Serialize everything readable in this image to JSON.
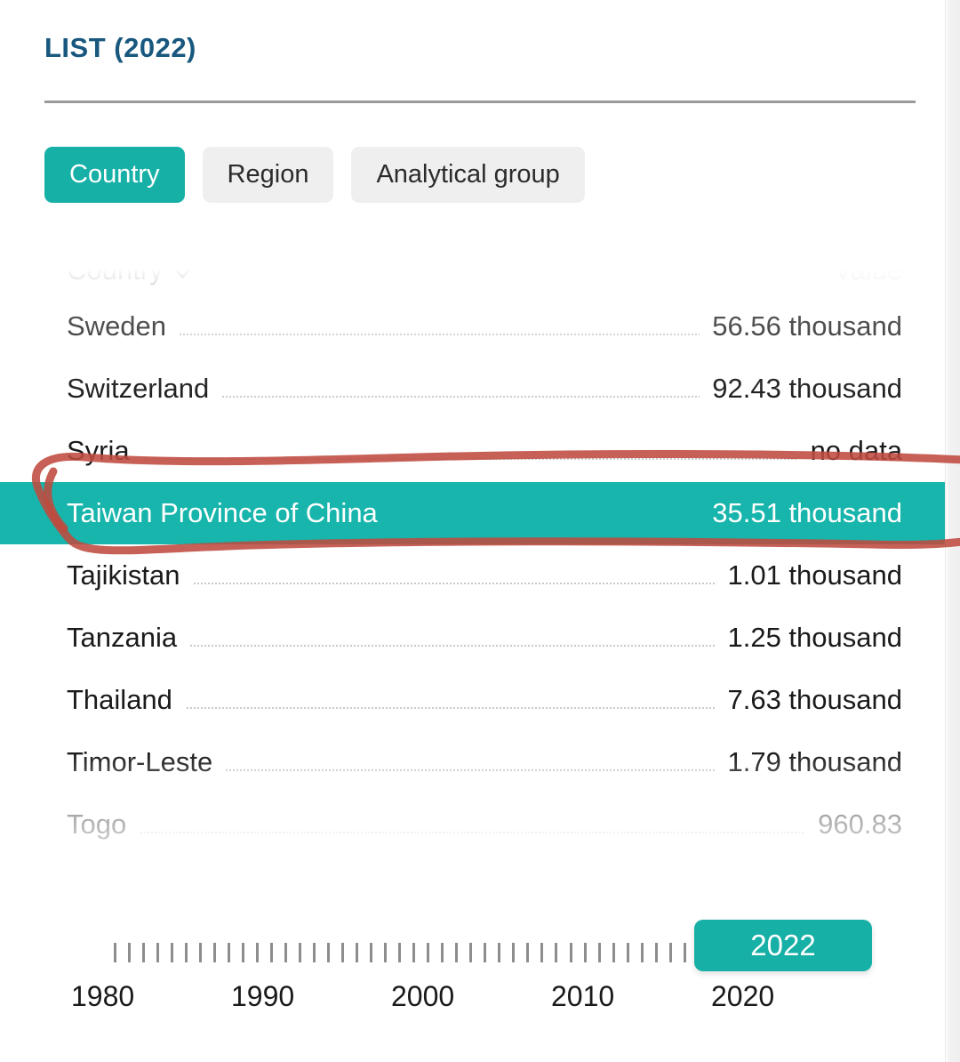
{
  "header": {
    "title": "LIST (2022)"
  },
  "tabs": [
    {
      "label": "Country",
      "active": true
    },
    {
      "label": "Region",
      "active": false
    },
    {
      "label": "Analytical group",
      "active": false
    }
  ],
  "list": {
    "columns": {
      "country": "Country",
      "value": "Value",
      "sort_icon": "chevron-down-icon"
    },
    "rows": [
      {
        "name": "Sweden",
        "value": "56.56 thousand",
        "state": "clipped"
      },
      {
        "name": "Switzerland",
        "value": "92.43 thousand",
        "state": "faded"
      },
      {
        "name": "Syria",
        "value": "no data",
        "state": "normal"
      },
      {
        "name": "Taiwan Province of China",
        "value": "35.51 thousand",
        "state": "selected"
      },
      {
        "name": "Tajikistan",
        "value": "1.01 thousand",
        "state": "normal"
      },
      {
        "name": "Tanzania",
        "value": "1.25 thousand",
        "state": "normal"
      },
      {
        "name": "Thailand",
        "value": "7.63 thousand",
        "state": "normal"
      },
      {
        "name": "Timor-Leste",
        "value": "1.79 thousand",
        "state": "normal"
      },
      {
        "name": "Togo",
        "value": "960.83",
        "state": "faded"
      }
    ]
  },
  "timeline": {
    "selected_year": "2022",
    "axis_labels": [
      "1980",
      "1990",
      "2000",
      "2010",
      "2020"
    ],
    "tick_count": 42,
    "range_start": 1980,
    "range_end": 2022
  },
  "annotation": {
    "type": "handwritten-ellipse",
    "color": "#bf4a3f",
    "target_row": "Taiwan Province of China"
  },
  "colors": {
    "accent_teal": "#17b0a7",
    "title_navy": "#18577e",
    "tab_inactive_bg": "#efefef",
    "annotation_red": "#bf4a3f",
    "muted_text": "#a8a8a8"
  }
}
